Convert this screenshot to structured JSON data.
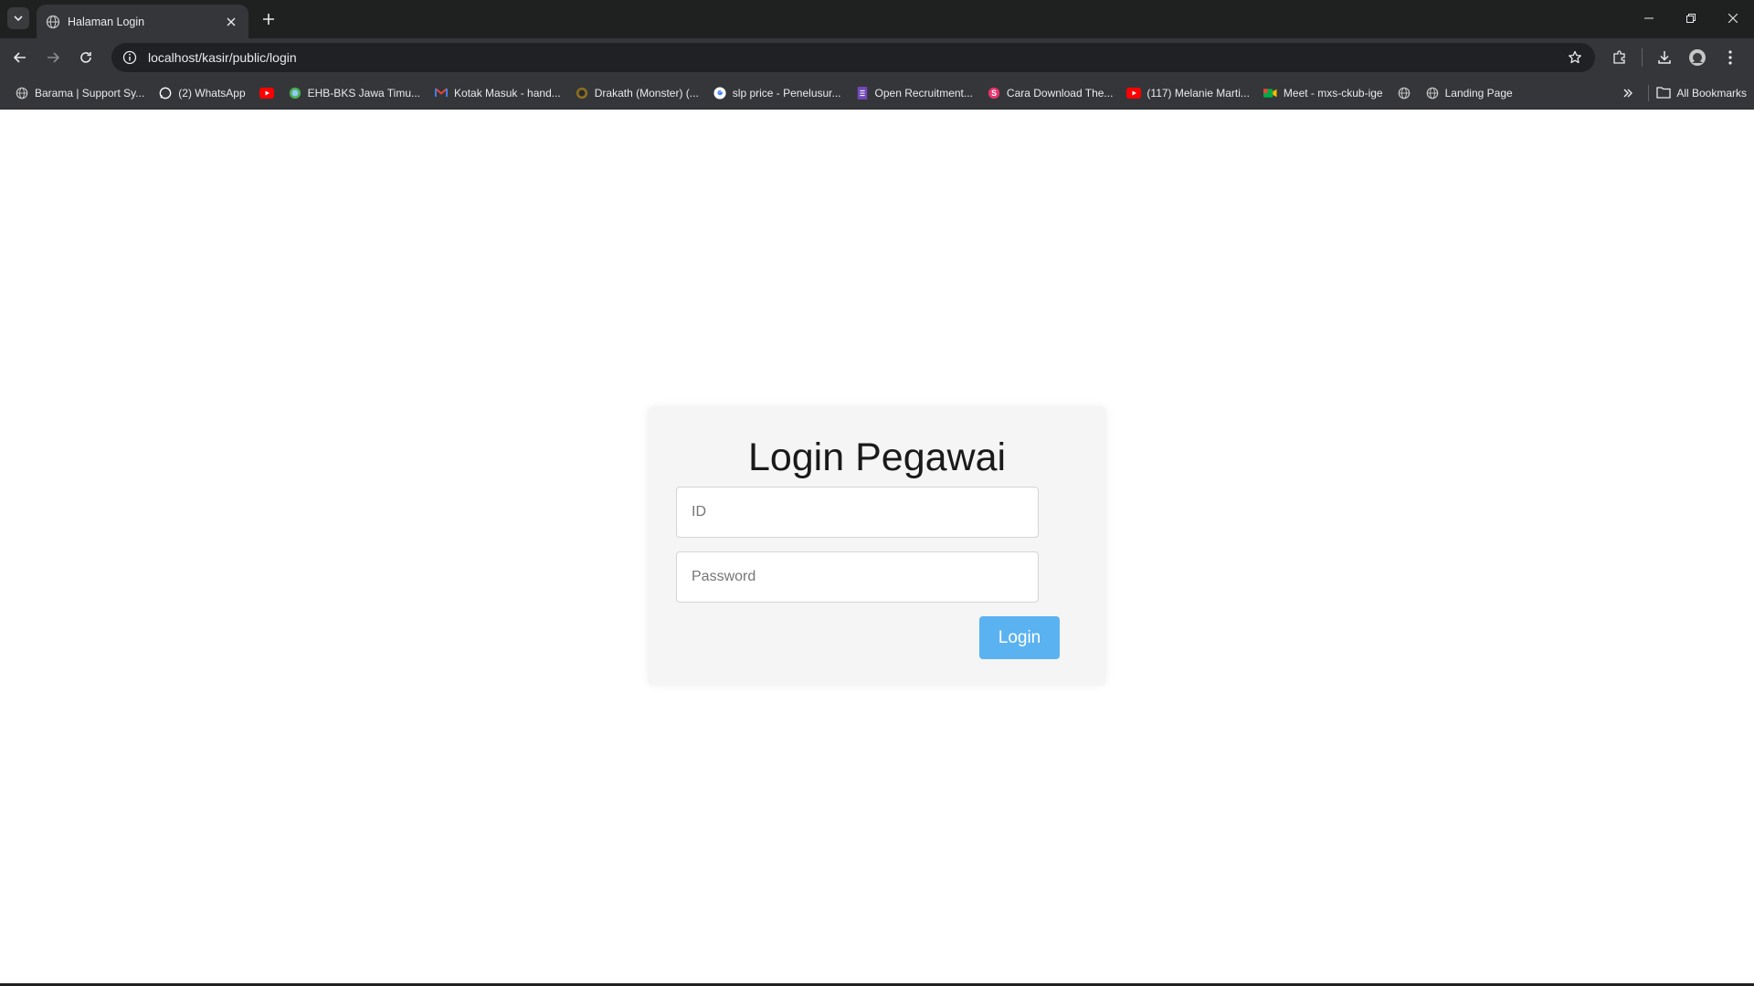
{
  "browser": {
    "tab": {
      "title": "Halaman Login"
    },
    "address": {
      "url": "localhost/kasir/public/login"
    },
    "bookmarks": [
      {
        "label": "Barama | Support Sy...",
        "icon": "globe-icon"
      },
      {
        "label": "(2) WhatsApp",
        "icon": "whatsapp-icon"
      },
      {
        "label": "",
        "icon": "youtube-icon"
      },
      {
        "label": "EHB-BKS Jawa Timu...",
        "icon": "ehb-icon"
      },
      {
        "label": "Kotak Masuk - hand...",
        "icon": "gmail-icon"
      },
      {
        "label": "Drakath (Monster) (...",
        "icon": "drakath-icon"
      },
      {
        "label": "slp price - Penelusur...",
        "icon": "google-icon"
      },
      {
        "label": "Open Recruitment...",
        "icon": "forms-icon"
      },
      {
        "label": "Cara Download The...",
        "icon": "s-icon"
      },
      {
        "label": "(117) Melanie Marti...",
        "icon": "youtube-icon"
      },
      {
        "label": "Meet - mxs-ckub-ige",
        "icon": "meet-icon"
      },
      {
        "label": "",
        "icon": "globe-icon"
      },
      {
        "label": "Landing Page",
        "icon": "globe-icon"
      }
    ],
    "all_bookmarks": "All Bookmarks"
  },
  "login": {
    "title": "Login Pegawai",
    "id_placeholder": "ID",
    "password_placeholder": "Password",
    "button_label": "Login"
  },
  "colors": {
    "button": "#5ab2f0",
    "card": "#f5f5f5",
    "browser_frame": "#35363a"
  }
}
